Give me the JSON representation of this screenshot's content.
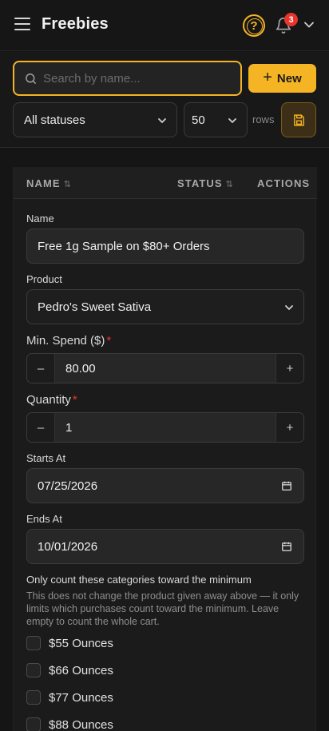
{
  "header": {
    "title": "Freebies",
    "notification_count": "3",
    "help_glyph": "?"
  },
  "toolbar": {
    "search_placeholder": "Search by name...",
    "new_label": "New",
    "status_filter": "All statuses",
    "rows_value": "50",
    "rows_label": "rows"
  },
  "table": {
    "columns": [
      "NAME",
      "STATUS",
      "ACTIONS"
    ]
  },
  "form": {
    "name_label": "Name",
    "name_value": "Free 1g Sample on $80+ Orders",
    "product_label": "Product",
    "product_value": "Pedro's Sweet Sativa",
    "min_spend_label": "Min. Spend ($)",
    "min_spend_value": "80.00",
    "quantity_label": "Quantity",
    "quantity_value": "1",
    "starts_label": "Starts At",
    "starts_value": "07/25/2026",
    "ends_label": "Ends At",
    "ends_value": "10/01/2026",
    "categories_title": "Only count these categories toward the minimum",
    "categories_hint": "This does not change the product given away above — it only limits which purchases count toward the minimum. Leave empty to count the whole cart.",
    "categories": [
      {
        "label": "$55 Ounces",
        "checked": false
      },
      {
        "label": "$66 Ounces",
        "checked": false
      },
      {
        "label": "$77 Ounces",
        "checked": false
      },
      {
        "label": "$88 Ounces",
        "checked": false
      }
    ]
  },
  "colors": {
    "accent": "#f5b424",
    "badge": "#e5352d",
    "background": "#151515"
  }
}
